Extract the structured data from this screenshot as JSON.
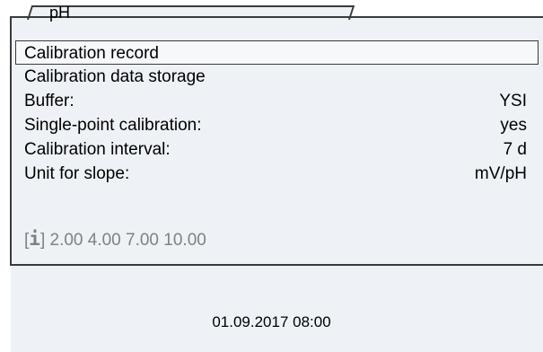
{
  "tab": {
    "label": "pH"
  },
  "menu": {
    "items": [
      {
        "label": "Calibration record",
        "value": ""
      },
      {
        "label": "Calibration data storage",
        "value": ""
      },
      {
        "label": "Buffer:",
        "value": "YSI"
      },
      {
        "label": "Single-point calibration:",
        "value": "yes"
      },
      {
        "label": "Calibration interval:",
        "value": "7 d"
      },
      {
        "label": "Unit for slope:",
        "value": "mV/pH"
      }
    ]
  },
  "info": {
    "icon": "info-icon",
    "icon_glyph": "i",
    "open_bracket": "[",
    "close_bracket": "]",
    "text": "2.00 4.00 7.00 10.00"
  },
  "status": {
    "datetime": "01.09.2017 08:00"
  }
}
